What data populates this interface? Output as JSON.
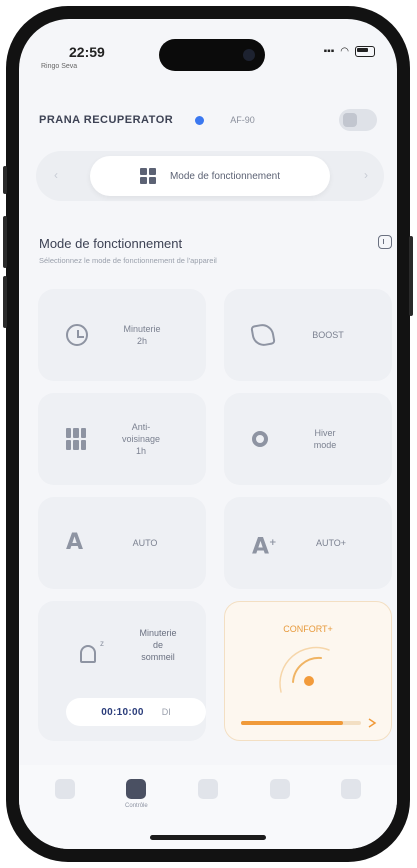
{
  "status_bar": {
    "time": "22:59",
    "subtitle": "Ringo Seva",
    "signal": "📶",
    "wifi": "WiFi"
  },
  "header": {
    "device_name": "PRANA RECUPERATOR",
    "device_code": "AF-90"
  },
  "mode_tab": {
    "label": "Mode de fonctionnement"
  },
  "section": {
    "title": "Mode de fonctionnement",
    "subtitle": "Sélectionnez le mode de fonctionnement de l'appareil"
  },
  "modes": [
    {
      "label": "Minuterie\n2h",
      "icon": "clock-icon"
    },
    {
      "label": "BOOST",
      "icon": "rocket-icon"
    },
    {
      "label": "Anti-\nvoisinage\n1h",
      "icon": "building-icon"
    },
    {
      "label": "Hiver\nmode",
      "icon": "flower-icon"
    },
    {
      "label": "AUTO",
      "icon": "letter-a-icon"
    },
    {
      "label": "AUTO+",
      "icon": "letter-a-plus-icon"
    }
  ],
  "sleep_mode": {
    "label": "Minuterie\nde\nsommeil",
    "timer": "00:10:00",
    "state": "DI"
  },
  "comfort_mode": {
    "label": "CONFORT+",
    "level": 0.85
  },
  "tabs": [
    {
      "label": ""
    },
    {
      "label": "Contrôle"
    },
    {
      "label": ""
    },
    {
      "label": ""
    },
    {
      "label": ""
    }
  ],
  "colors": {
    "accent_blue": "#3b78f0",
    "comfort_orange": "#e79a3c",
    "timer_text": "#2a3c7a"
  }
}
